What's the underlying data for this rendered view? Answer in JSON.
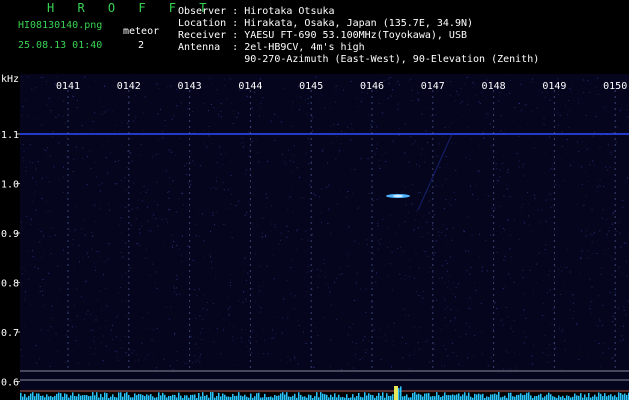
{
  "brand": "H R O F F T",
  "file": "HI08130140.png",
  "datetime": "25.08.13 01:40",
  "meteor_label": "meteor",
  "meteor_count": "2",
  "info": {
    "observer": "Observer : Hirotaka Otsuka",
    "location": "Location : Hirakata, Osaka, Japan (135.7E, 34.9N)",
    "receiver": "Receiver : YAESU FT-690 53.100MHz(Toyokawa), USB",
    "antenna": "Antenna  : 2el-HB9CV, 4m's high",
    "antenna2": "           90-270-Azimuth (East-West), 90-Elevation (Zenith)"
  },
  "axis": {
    "unit": "kHz",
    "x_ticks": [
      "0141",
      "0142",
      "0143",
      "0144",
      "0145",
      "0146",
      "0147",
      "0148",
      "0149",
      "0150"
    ],
    "y_ticks": [
      "1.1",
      "1.0",
      "0.9",
      "0.8",
      "0.7",
      "0.6"
    ]
  },
  "colors": {
    "background": "#000000",
    "spectrum_bg": "#05051e",
    "carrier": "#2c4cff",
    "echo": "#4fb4ff",
    "label_green": "#39d353",
    "axis_text": "#ffffff",
    "meter": "#29c6ff"
  }
}
